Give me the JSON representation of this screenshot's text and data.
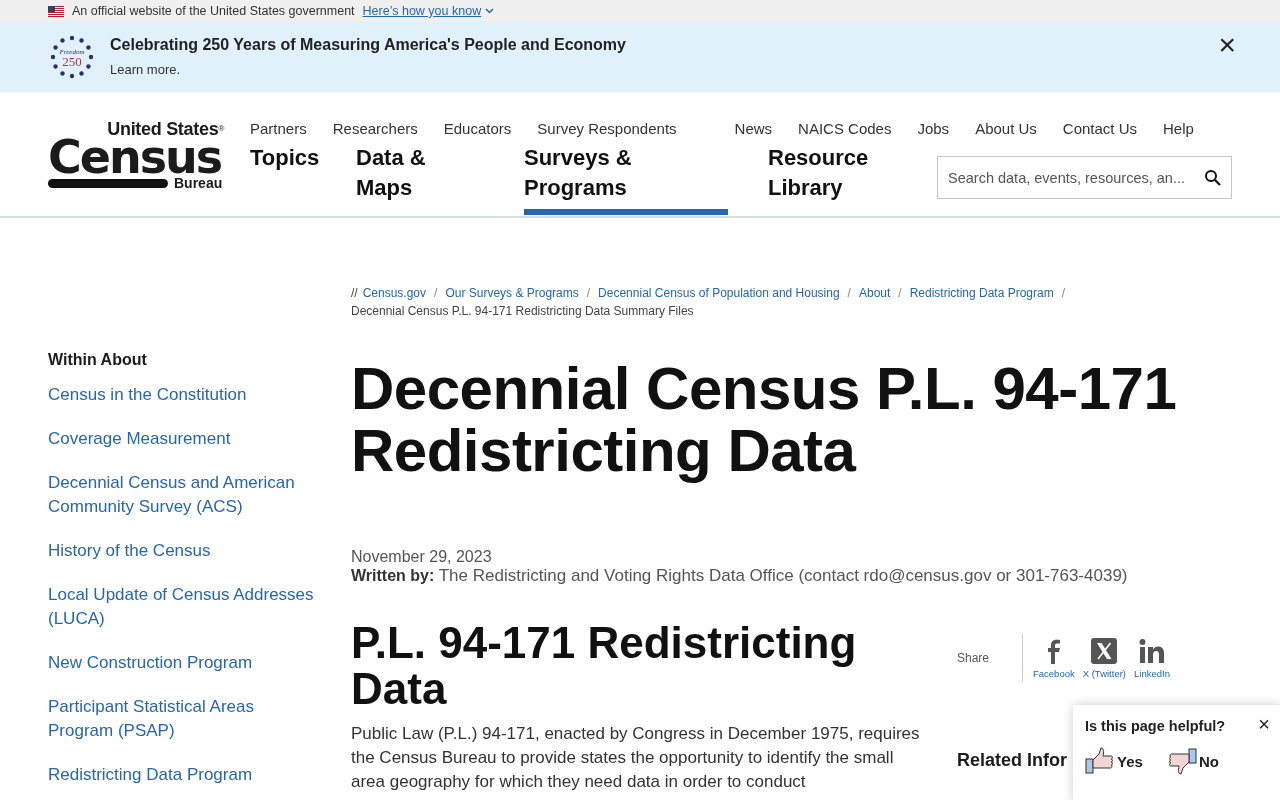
{
  "gov_banner": {
    "text": "An official website of the United States government",
    "link": "Here’s how you know"
  },
  "announcement": {
    "logo_text": "Freedom",
    "logo_number": "250",
    "title": "Celebrating 250 Years of Measuring America's People and Economy",
    "link": "Learn more.",
    "close": "×"
  },
  "header": {
    "logo": {
      "top": "United States",
      "registered": "®",
      "main": "Census",
      "bottom": "Bureau"
    },
    "utility_links": [
      "Partners",
      "Researchers",
      "Educators",
      "Survey Respondents",
      "News",
      "NAICS Codes",
      "Jobs",
      "About Us",
      "Contact Us",
      "Help"
    ],
    "main_nav": [
      {
        "label": "Topics",
        "selected": false
      },
      {
        "label": "Data & Maps",
        "selected": false
      },
      {
        "label": "Surveys & Programs",
        "selected": true
      },
      {
        "label": "Resource Library",
        "selected": false
      }
    ],
    "search": {
      "placeholder": "Search data, events, resources, an..."
    }
  },
  "sidebar": {
    "heading": "Within About",
    "items": [
      "Census in the Constitution",
      "Coverage Measurement",
      "Decennial Census and American Community Survey (ACS)",
      "History of the Census",
      "Local Update of Census Addresses (LUCA)",
      "New Construction Program",
      "Participant Statistical Areas Program (PSAP)",
      "Redistricting Data Program"
    ]
  },
  "breadcrumb": {
    "prefix": "//",
    "links": [
      {
        "label": "Census.gov",
        "separator": "/"
      },
      {
        "label": "Our Surveys & Programs",
        "separator": "/"
      },
      {
        "label": "Decennial Census of Population and Housing",
        "separator": "/"
      },
      {
        "label": "About",
        "separator": "/"
      },
      {
        "label": "Redistricting Data Program",
        "separator": "/"
      }
    ],
    "current": "Decennial Census P.L. 94-171 Redistricting Data Summary Files"
  },
  "article": {
    "title": "Decennial Census P.L. 94-171 Redistricting Data",
    "date": "November 29, 2023",
    "written_by_label": "Written by:",
    "written_by": "The Redistricting and Voting Rights Data Office (contact rdo@census.gov or 301-763-4039)",
    "section_title": "P.L. 94-171 Redistricting Data",
    "paragraph": "Public Law (P.L.) 94-171, enacted by Congress in December 1975, requires the Census Bureau to provide states the opportunity to identify the small area geography for which they need data in order to conduct"
  },
  "share": {
    "label": "Share",
    "items": [
      {
        "kind": "facebook",
        "label": "Facebook"
      },
      {
        "kind": "x",
        "label": "X (Twitter)"
      },
      {
        "kind": "linkedin",
        "label": "LinkedIn"
      }
    ]
  },
  "related_heading": "Related Infor",
  "feedback": {
    "question": "Is this page helpful?",
    "close": "×",
    "yes": "Yes",
    "no": "No"
  }
}
